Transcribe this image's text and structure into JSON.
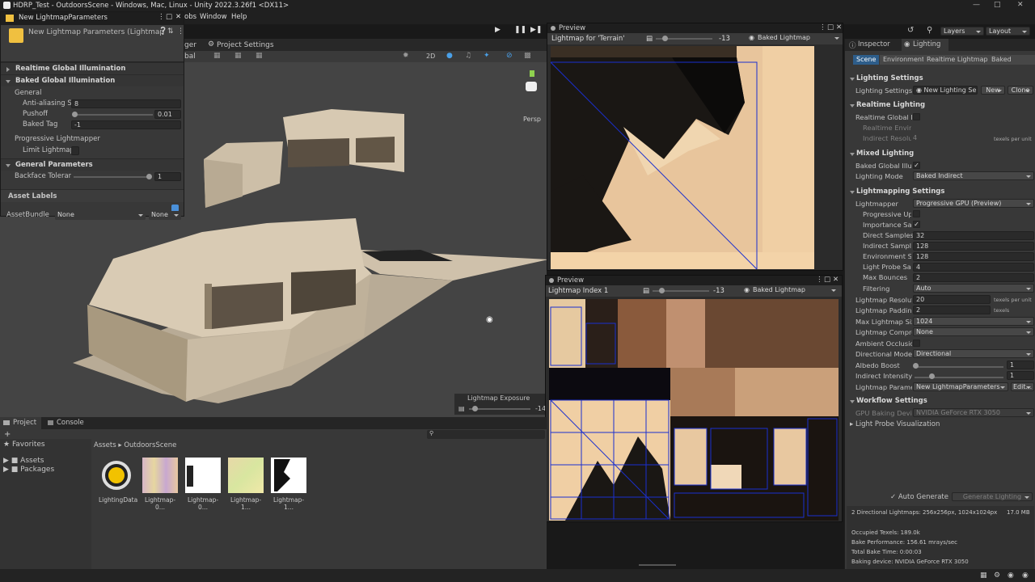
{
  "window": {
    "title": "HDRP_Test - OutdoorsScene - Windows, Mac, Linux - Unity 2022.3.26f1 <DX11>"
  },
  "menu": {
    "items": [
      "Window",
      "Help"
    ],
    "partial": "obs"
  },
  "toolbar": {
    "layers": "Layers",
    "layout": "Layout",
    "project_settings": "Project Settings",
    "manager_partial": "ger",
    "global_partial": "bal",
    "mode_2d": "2D"
  },
  "params_window": {
    "tab": "New LightmapParameters",
    "asset_title": "New Lightmap Parameters (Lightmap",
    "realtime_gi": "Realtime Global Illumination",
    "baked_gi": "Baked Global Illumination",
    "general": "General",
    "anti_aliasing_label": "Anti-aliasing Sa",
    "anti_aliasing_value": "8",
    "pushoff_label": "Pushoff",
    "pushoff_value": "0.01",
    "baked_tag_label": "Baked Tag",
    "baked_tag_value": "-1",
    "progressive": "Progressive Lightmapper",
    "limit_label": "Limit Lightmap C",
    "general_params": "General Parameters",
    "backface_label": "Backface Toleranc",
    "backface_value": "1",
    "asset_labels": "Asset Labels",
    "assetbundle_label": "AssetBundle",
    "assetbundle_value": "None",
    "assetbundle_variant": "None"
  },
  "scene": {
    "persp": "Persp",
    "exposure_label": "Lightmap Exposure",
    "exposure_value": "-14"
  },
  "preview1": {
    "tab": "Preview",
    "title": "Lightmap for 'Terrain'",
    "exposure": "-13",
    "mode": "Baked Lightmap"
  },
  "preview2": {
    "tab": "Preview",
    "title": "Lightmap Index 1",
    "exposure": "-13",
    "mode": "Baked Lightmap"
  },
  "project": {
    "tabs": [
      "Project",
      "Console"
    ],
    "favorites": "Favorites",
    "assets": "Assets",
    "packages": "Packages",
    "breadcrumb": [
      "Assets",
      "OutdoorsScene"
    ],
    "files": [
      "LightingData",
      "Lightmap-0...",
      "Lightmap-0...",
      "Lightmap-1...",
      "Lightmap-1..."
    ]
  },
  "inspector": {
    "tabs": [
      "Inspector",
      "Lighting"
    ],
    "subtabs": [
      "Scene",
      "Environment",
      "Realtime Lightmaps",
      "Baked Lightma"
    ],
    "lighting_settings": {
      "header": "Lighting Settings",
      "label": "Lighting Settings A",
      "asset": "New Lighting Se",
      "new": "New",
      "clone": "Clone"
    },
    "realtime": {
      "header": "Realtime Lighting",
      "gi": "Realtime Global Illu",
      "env": "Realtime Enviro",
      "res_label": "Indirect Resoluti",
      "res_value": "4",
      "res_unit": "texels per unit"
    },
    "mixed": {
      "header": "Mixed Lighting",
      "baked_gi": "Baked Global Illum",
      "mode_label": "Lighting Mode",
      "mode_value": "Baked Indirect"
    },
    "lightmapping": {
      "header": "Lightmapping Settings",
      "lightmapper_label": "Lightmapper",
      "lightmapper_value": "Progressive GPU (Preview)",
      "progressive_upd": "Progressive Upd",
      "importance": "Importance Sam",
      "direct_label": "Direct Samples",
      "direct_value": "32",
      "indirect_label": "Indirect Sample",
      "indirect_value": "128",
      "env_label": "Environment Sa",
      "env_value": "128",
      "probe_label": "Light Probe Sam",
      "probe_value": "4",
      "bounces_label": "Max Bounces",
      "bounces_value": "2",
      "filtering_label": "Filtering",
      "filtering_value": "Auto",
      "resolution_label": "Lightmap Resolutio",
      "resolution_value": "20",
      "resolution_unit": "texels per unit",
      "padding_label": "Lightmap Padding",
      "padding_value": "2",
      "padding_unit": "texels",
      "maxsize_label": "Max Lightmap Size",
      "maxsize_value": "1024",
      "compress_label": "Lightmap Compres",
      "compress_value": "None",
      "ao_label": "Ambient Occlusion",
      "dirmode_label": "Directional Mode",
      "dirmode_value": "Directional",
      "albedo_label": "Albedo Boost",
      "albedo_value": "1",
      "intensity_label": "Indirect Intensity",
      "intensity_value": "1",
      "params_label": "Lightmap Paramete",
      "params_value": "New LightmapParameters",
      "edit": "Edit..."
    },
    "workflow": {
      "header": "Workflow Settings",
      "gpu_label": "GPU Baking Devic",
      "gpu_value": "NVIDIA GeForce RTX 3050",
      "probe_vis": "Light Probe Visualization"
    },
    "auto_generate": "Auto Generate",
    "generate": "Generate Lighting",
    "stats": {
      "lightmaps": "2 Directional Lightmaps: 256x256px, 1024x1024px",
      "size": "17.0 MB",
      "occupied": "Occupied Texels: 189.0k",
      "performance": "Bake Performance: 156.61 mrays/sec",
      "time": "Total Bake Time: 0:00:03",
      "device": "Baking device: NVIDIA GeForce RTX 3050"
    }
  }
}
